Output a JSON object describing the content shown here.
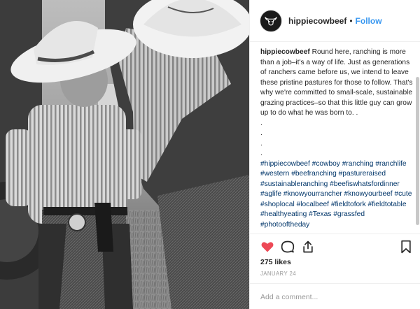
{
  "header": {
    "username": "hippiecowbeef",
    "separator": "•",
    "follow_label": "Follow",
    "avatar_icon": "bull-skull-icon"
  },
  "caption": {
    "username": "hippiecowbeef",
    "text": "Round here, ranching is more than a job–it's a way of life. Just as generations of ranchers came before us, we intend to leave these pristine pastures for those to follow. That's why we're committed to small-scale, sustainable grazing practices–so that this little guy can grow up to do what he was born to. .",
    "dots": [
      ".",
      ".",
      ".",
      "."
    ],
    "hashtags": [
      "#hippiecowbeef",
      "#cowboy",
      "#ranching",
      "#ranchlife",
      "#western",
      "#beefranching",
      "#pastureraised",
      "#sustainableranching",
      "#beefiswhatsfordinner",
      "#aglife",
      "#knowyourrancher",
      "#knowyourbeef",
      "#cute",
      "#shoplocal",
      "#localbeef",
      "#fieldtofork",
      "#fieldtotable",
      "#healthyeating",
      "#Texas",
      "#grassfed",
      "#photooftheday"
    ]
  },
  "actions": {
    "icons": [
      "heart-icon",
      "comment-icon",
      "share-icon",
      "bookmark-icon"
    ],
    "likes_text": "275 likes",
    "date_text": "JANUARY 24",
    "liked_color": "#ed4956"
  },
  "comment": {
    "placeholder": "Add a comment..."
  },
  "colors": {
    "link": "#003569",
    "follow": "#3897f0",
    "border": "#efefef",
    "muted": "#999999"
  }
}
